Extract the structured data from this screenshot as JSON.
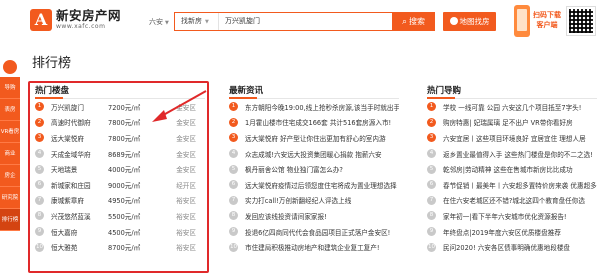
{
  "header": {
    "logo_text": "新安房产网",
    "logo_url": "www.xafc.com",
    "logo_mark": "A",
    "city": "六安",
    "search_type": "找新房",
    "search_value": "万兴凯旋门",
    "search_button": "搜索",
    "map_button": "地图找房",
    "app_line1": "扫码下载",
    "app_line2": "客户端"
  },
  "sidebar": {
    "items": [
      "导购",
      "表房",
      "VR看房",
      "商业",
      "房企",
      "研究院",
      "排行榜"
    ]
  },
  "page_title": "排行榜",
  "hot_projects": {
    "title": "热门楼盘",
    "rows": [
      {
        "rank": "1",
        "name": "万兴凯旋门",
        "price": "7200元/㎡",
        "area": "金安区"
      },
      {
        "rank": "2",
        "name": "高速时代御府",
        "price": "7800元/㎡",
        "area": "金安区"
      },
      {
        "rank": "3",
        "name": "远大棠悦府",
        "price": "7800元/㎡",
        "area": "金安区"
      },
      {
        "rank": "4",
        "name": "天成金域华府",
        "price": "8689元/㎡",
        "area": "金安区"
      },
      {
        "rank": "5",
        "name": "天地瑞景",
        "price": "4000元/㎡",
        "area": "金安区"
      },
      {
        "rank": "6",
        "name": "新城家和庄园",
        "price": "9000元/㎡",
        "area": "经开区"
      },
      {
        "rank": "7",
        "name": "康城紫章府",
        "price": "4950元/㎡",
        "area": "裕安区"
      },
      {
        "rank": "8",
        "name": "兴茂悠然蓝溪",
        "price": "5500元/㎡",
        "area": "裕安区"
      },
      {
        "rank": "9",
        "name": "恒大嘉府",
        "price": "4500元/㎡",
        "area": "裕安区"
      },
      {
        "rank": "10",
        "name": "恒大雅苑",
        "price": "8700元/㎡",
        "area": "裕安区"
      }
    ]
  },
  "news": {
    "title": "最新资讯",
    "rows": [
      {
        "rank": "1",
        "text": "东方朝阳今晚19:00,线上抢秒杀房源,该当手时就出手"
      },
      {
        "rank": "2",
        "text": "1月霍山楼市住宅成交166套 共计516套房源入市!"
      },
      {
        "rank": "3",
        "text": "远大棠悦府 好产型让你住出更加有舒心的室内游"
      },
      {
        "rank": "4",
        "text": "众志成城!六安远大投资集团暖心捐款 抱薪六安"
      },
      {
        "rank": "5",
        "text": "枫丹丽舍公馆 物业独门富怎么办?"
      },
      {
        "rank": "6",
        "text": "远大棠悦府疫情过后领您度住宅将成为置业理想选择"
      },
      {
        "rank": "7",
        "text": "实力打call!万创新翻经纪人评选上线"
      },
      {
        "rank": "8",
        "text": "发回应该线投资请间家家报!"
      },
      {
        "rank": "9",
        "text": "投退6亿四商同代代会食品园项目正式落户金安区!"
      },
      {
        "rank": "10",
        "text": "市住建局积极推动房地产和建筑企业复工复产!"
      }
    ]
  },
  "guides": {
    "title": "热门导购",
    "rows": [
      {
        "rank": "1",
        "text": "学校 一线可靠 公园 六安这几个项目抵至7字头!"
      },
      {
        "rank": "2",
        "text": "购房特惠| 妃瑞属璃 足不出户 VR带你看好房"
      },
      {
        "rank": "3",
        "text": "六安宜居丨这些项目环境良好 宜居宜住 理想人居"
      },
      {
        "rank": "4",
        "text": "返乡置业最值得入手 这些热门楼盘是你的不二之选!"
      },
      {
        "rank": "5",
        "text": "乾邻房|劳动精神 这些在售城市新房比比成功"
      },
      {
        "rank": "6",
        "text": "春节促销丨最美年丨六安超多置特价房来袭 优惠超多!"
      },
      {
        "rank": "7",
        "text": "在住六安老城区还不错?城北这四个教育盘任你选"
      },
      {
        "rank": "8",
        "text": "家年初一|看下半年六安城市优化资源报告!"
      },
      {
        "rank": "9",
        "text": "年终盘点|2019年度六安区优质楼盘推荐"
      },
      {
        "rank": "10",
        "text": "民问2020! 六安各区债事明确优惠地段楼盘"
      }
    ]
  },
  "colors": {
    "brand": "#f25a1e",
    "highlight_frame": "#e0292a"
  }
}
